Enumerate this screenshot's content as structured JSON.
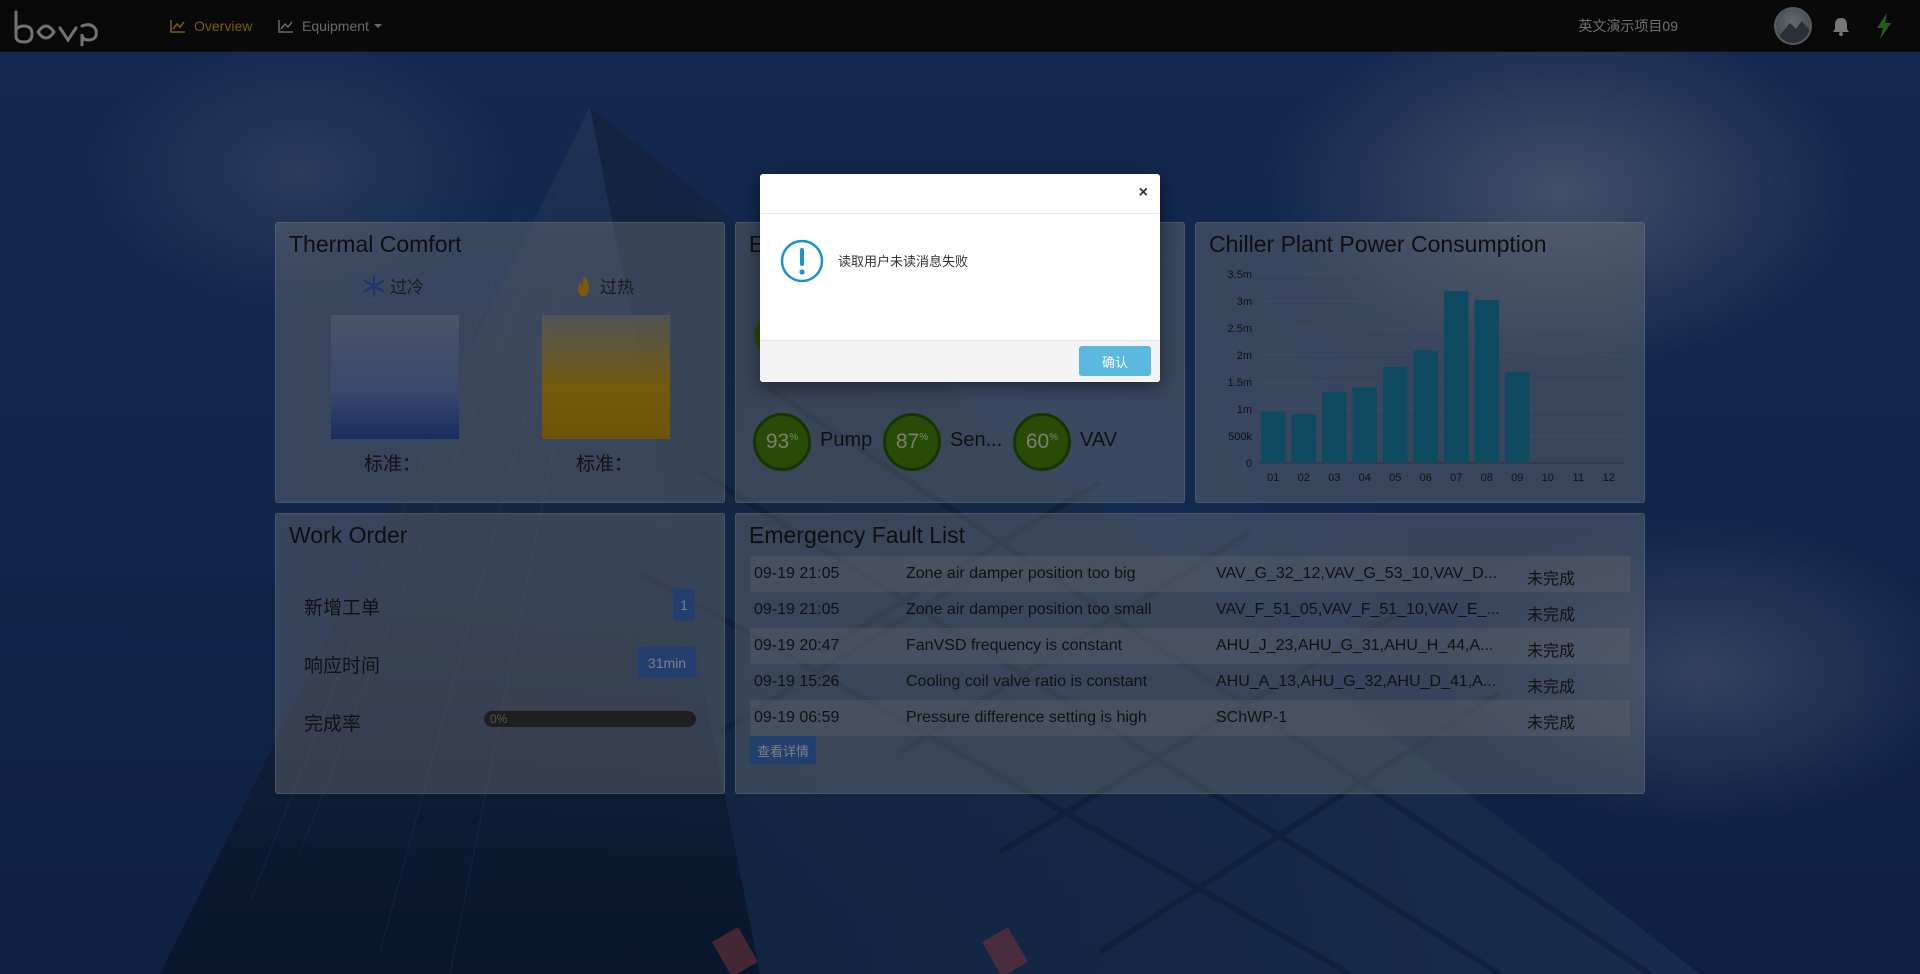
{
  "nav": {
    "overview_label": "Overview",
    "equipment_label": "Equipment",
    "project_name": "英文演示项目09"
  },
  "thermal_comfort": {
    "title": "Thermal Comfort",
    "cold_label": "过冷",
    "hot_label": "过热",
    "cold_std": "标准：",
    "hot_std": "标准："
  },
  "energy": {
    "title_visible": "E",
    "gauges": [
      {
        "value": "93",
        "unit": "%",
        "label": "Pump"
      },
      {
        "value": "87",
        "unit": "%",
        "label": "Sen..."
      },
      {
        "value": "60",
        "unit": "%",
        "label": "VAV"
      }
    ]
  },
  "chart_data": {
    "type": "bar",
    "title": "Chiller Plant Power Consumption",
    "categories": [
      "01",
      "02",
      "03",
      "04",
      "05",
      "06",
      "07",
      "08",
      "09",
      "10",
      "11",
      "12"
    ],
    "values": [
      950000,
      900000,
      1320000,
      1400000,
      1780000,
      2080000,
      3180000,
      3020000,
      1680000,
      0,
      0,
      0
    ],
    "y_ticks": [
      "0",
      "500k",
      "1m",
      "1.5m",
      "2m",
      "2.5m",
      "3m",
      "3.5m"
    ],
    "ylim": [
      0,
      3500000
    ],
    "bar_color": "#1b87b0",
    "grid": true
  },
  "work_order": {
    "title": "Work Order",
    "new_label": "新增工单",
    "new_count": "1",
    "response_label": "响应时间",
    "response_value": "31min",
    "completion_label": "完成率",
    "completion_value": "0%"
  },
  "fault_list": {
    "title": "Emergency Fault List",
    "rows": [
      {
        "time": "09-19 21:05",
        "desc": "Zone air damper position too big",
        "device": "VAV_G_32_12,VAV_G_53_10,VAV_D...",
        "status": "未完成"
      },
      {
        "time": "09-19 21:05",
        "desc": "Zone air damper position too small",
        "device": "VAV_F_51_05,VAV_F_51_10,VAV_E_...",
        "status": "未完成"
      },
      {
        "time": "09-19 20:47",
        "desc": "FanVSD frequency is constant",
        "device": "AHU_J_23,AHU_G_31,AHU_H_44,A...",
        "status": "未完成"
      },
      {
        "time": "09-19 15:26",
        "desc": "Cooling coil valve ratio is constant",
        "device": "AHU_A_13,AHU_G_32,AHU_D_41,A...",
        "status": "未完成"
      },
      {
        "time": "09-19 06:59",
        "desc": "Pressure difference setting is high",
        "device": "SChWP-1",
        "status": "未完成"
      }
    ],
    "detail_button": "查看详情"
  },
  "modal": {
    "close_glyph": "×",
    "message": "读取用户未读消息失败",
    "ok_label": "确认"
  },
  "colors": {
    "accent": "#e3a21a",
    "navbar": "#121212",
    "badge": "#3e73c6",
    "ok_button": "#5bb8df",
    "gauge_green": "#4a8a10"
  }
}
